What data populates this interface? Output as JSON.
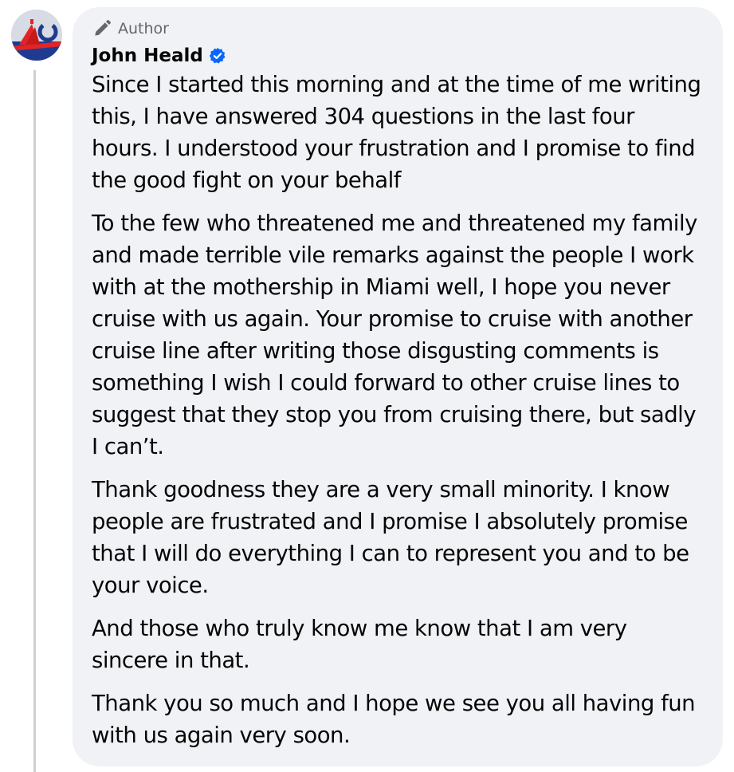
{
  "comment": {
    "badge_label": "Author",
    "author_name": "John Heald",
    "paragraphs": [
      "Since I started this morning and at the time of me writing this, I have answered 304 questions in the last four hours. I understood your frustration and I promise to find the good fight on your behalf",
      "To the few who threatened me and threatened my family and made terrible vile remarks against the people I work with at the mothership in Miami well, I hope you never cruise with us again. Your promise to cruise with another cruise line after writing those disgusting comments is something I wish I could forward to other cruise lines to suggest that they stop you from cruising there, but sadly I can’t.",
      "Thank goodness they are a very small minority. I know people are frustrated and I promise I absolutely promise that I will do everything I can to represent you and to be your voice.",
      "And those who truly know me know that I am very sincere in that.",
      "Thank you so much and I hope we see you all having fun with us again very soon."
    ]
  },
  "colors": {
    "bubble_background": "#f0f2f5",
    "secondary_text": "#65676b",
    "verified_blue": "#0866ff",
    "thread_line": "#ced0d4"
  },
  "icons": {
    "badge_icon": "pencil-icon",
    "verified_icon": "verified-badge-icon"
  }
}
